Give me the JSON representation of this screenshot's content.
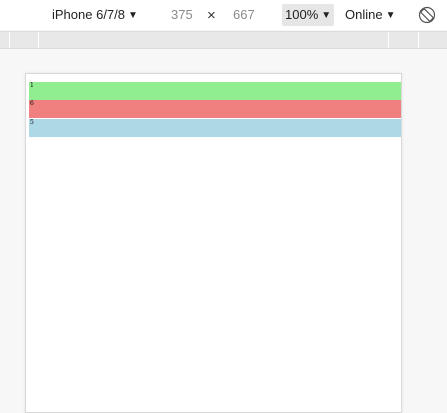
{
  "toolbar": {
    "device": "iPhone 6/7/8",
    "width": "375",
    "times": "×",
    "height": "667",
    "zoom": "100%",
    "network": "Online",
    "rotate_icon": "rotate-icon",
    "caret_icon": "▼"
  },
  "viewport": {
    "blocks": [
      {
        "label": "1",
        "color": "#90ee90"
      },
      {
        "label": "6",
        "color": "#f08080"
      },
      {
        "label": "5",
        "color": "#add8e6"
      }
    ]
  }
}
